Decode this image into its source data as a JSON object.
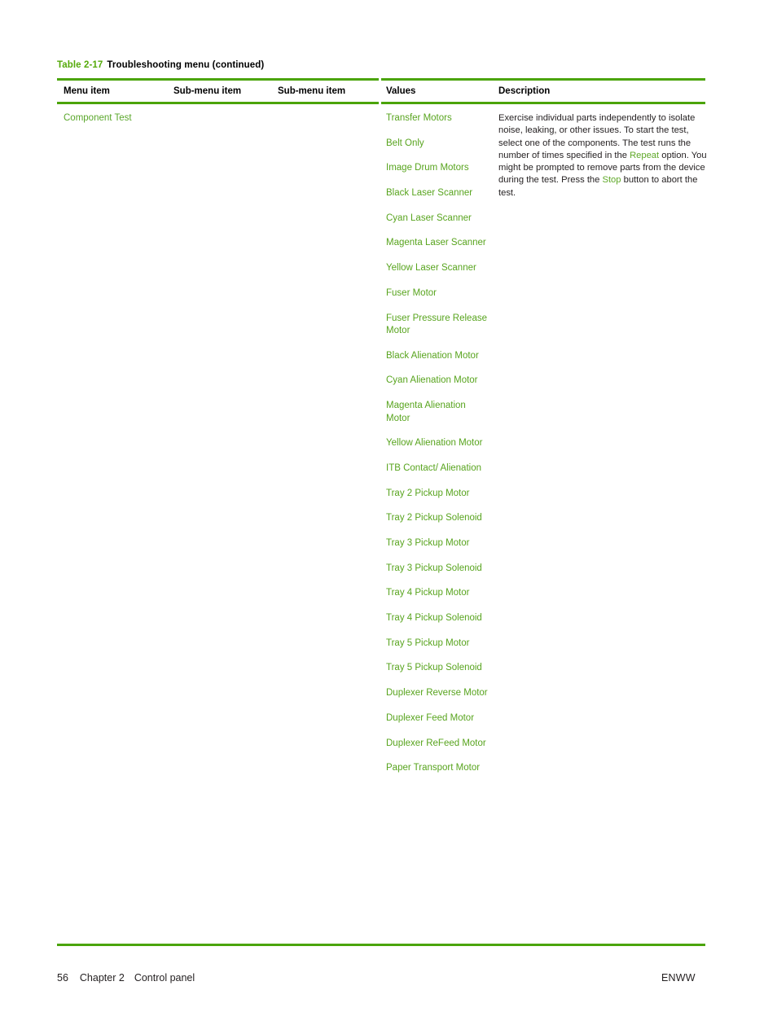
{
  "document": {
    "caption_number": "Table 2-17",
    "caption_text": "Troubleshooting menu (continued)",
    "accent_color": "#4ba40a",
    "link_color": "#58a41e",
    "body_color": "#231f20"
  },
  "table": {
    "headers": [
      "Menu item",
      "Sub-menu item",
      "Sub-menu item",
      "Values",
      "Description"
    ],
    "row": {
      "menu_item": "Component Test",
      "sub_menu_item_1": "",
      "sub_menu_item_2": "",
      "values": [
        "Transfer Motors",
        "Belt Only",
        "Image Drum Motors",
        "Black Laser Scanner",
        "Cyan Laser Scanner",
        "Magenta Laser Scanner",
        "Yellow Laser Scanner",
        "Fuser Motor",
        "Fuser Pressure Release Motor",
        "Black Alienation Motor",
        "Cyan Alienation Motor",
        "Magenta Alienation Motor",
        "Yellow Alienation Motor",
        "ITB Contact/ Alienation",
        "Tray 2 Pickup Motor",
        "Tray 2 Pickup Solenoid",
        "Tray 3 Pickup Motor",
        "Tray 3 Pickup Solenoid",
        "Tray 4 Pickup Motor",
        "Tray 4 Pickup Solenoid",
        "Tray 5 Pickup Motor",
        "Tray 5 Pickup Solenoid",
        "Duplexer Reverse Motor",
        "Duplexer Feed Motor",
        "Duplexer ReFeed Motor",
        "Paper Transport Motor"
      ],
      "description": {
        "part_1": "Exercise individual parts independently to isolate noise, leaking, or other issues. To start the test, select one of the components. The test runs the number of times specified in the ",
        "keyword_1": "Repeat",
        "part_2": " option. You might be prompted to remove parts from the device during the test. Press the ",
        "keyword_2": "Stop",
        "part_3": " button to abort the test."
      }
    }
  },
  "footer": {
    "page_number": "56",
    "chapter": "Chapter 2",
    "section": "Control panel",
    "locale": "ENWW"
  }
}
